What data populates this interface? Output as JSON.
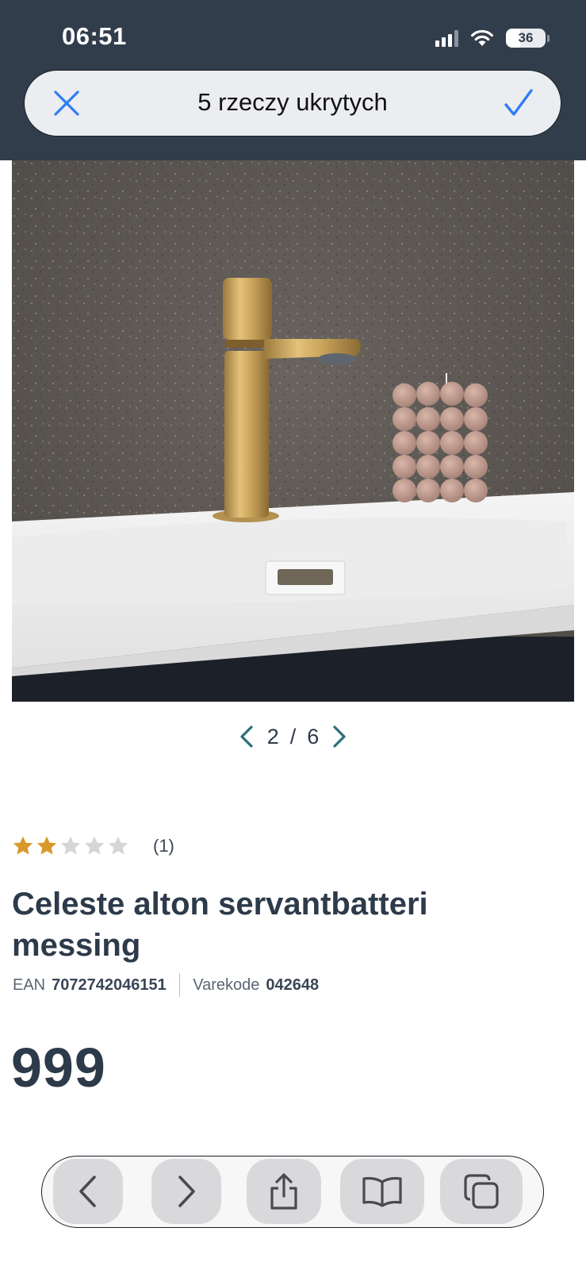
{
  "status_bar": {
    "time": "06:51",
    "battery": "36",
    "battery_level": 0.36
  },
  "find_bar": {
    "query_label": "5 rzeczy ukrytych",
    "close_icon": "close-icon",
    "done_icon": "checkmark-icon"
  },
  "gallery": {
    "current": "2",
    "separator": "/",
    "total": "6",
    "prev_icon": "chevron-left-icon",
    "next_icon": "chevron-right-icon"
  },
  "product": {
    "rating_value": 2,
    "rating_max": 5,
    "rating_count": "(1)",
    "title": "Celeste alton servantbatteri messing",
    "ean_label": "EAN",
    "ean_value": "7072742046151",
    "sku_label": "Varekode",
    "sku_value": "042648",
    "price": "999"
  },
  "toolbar": {
    "buttons": [
      "back-icon",
      "forward-icon",
      "share-icon",
      "bookmarks-icon",
      "tabs-icon"
    ]
  },
  "colors": {
    "header_bg": "#323d4c",
    "accent_blue": "#2f7df6",
    "star_filled": "#d8982a",
    "star_empty": "#d6d6d6",
    "pager_arrow": "#2b6f7e",
    "text_dark": "#2d3a4a"
  }
}
